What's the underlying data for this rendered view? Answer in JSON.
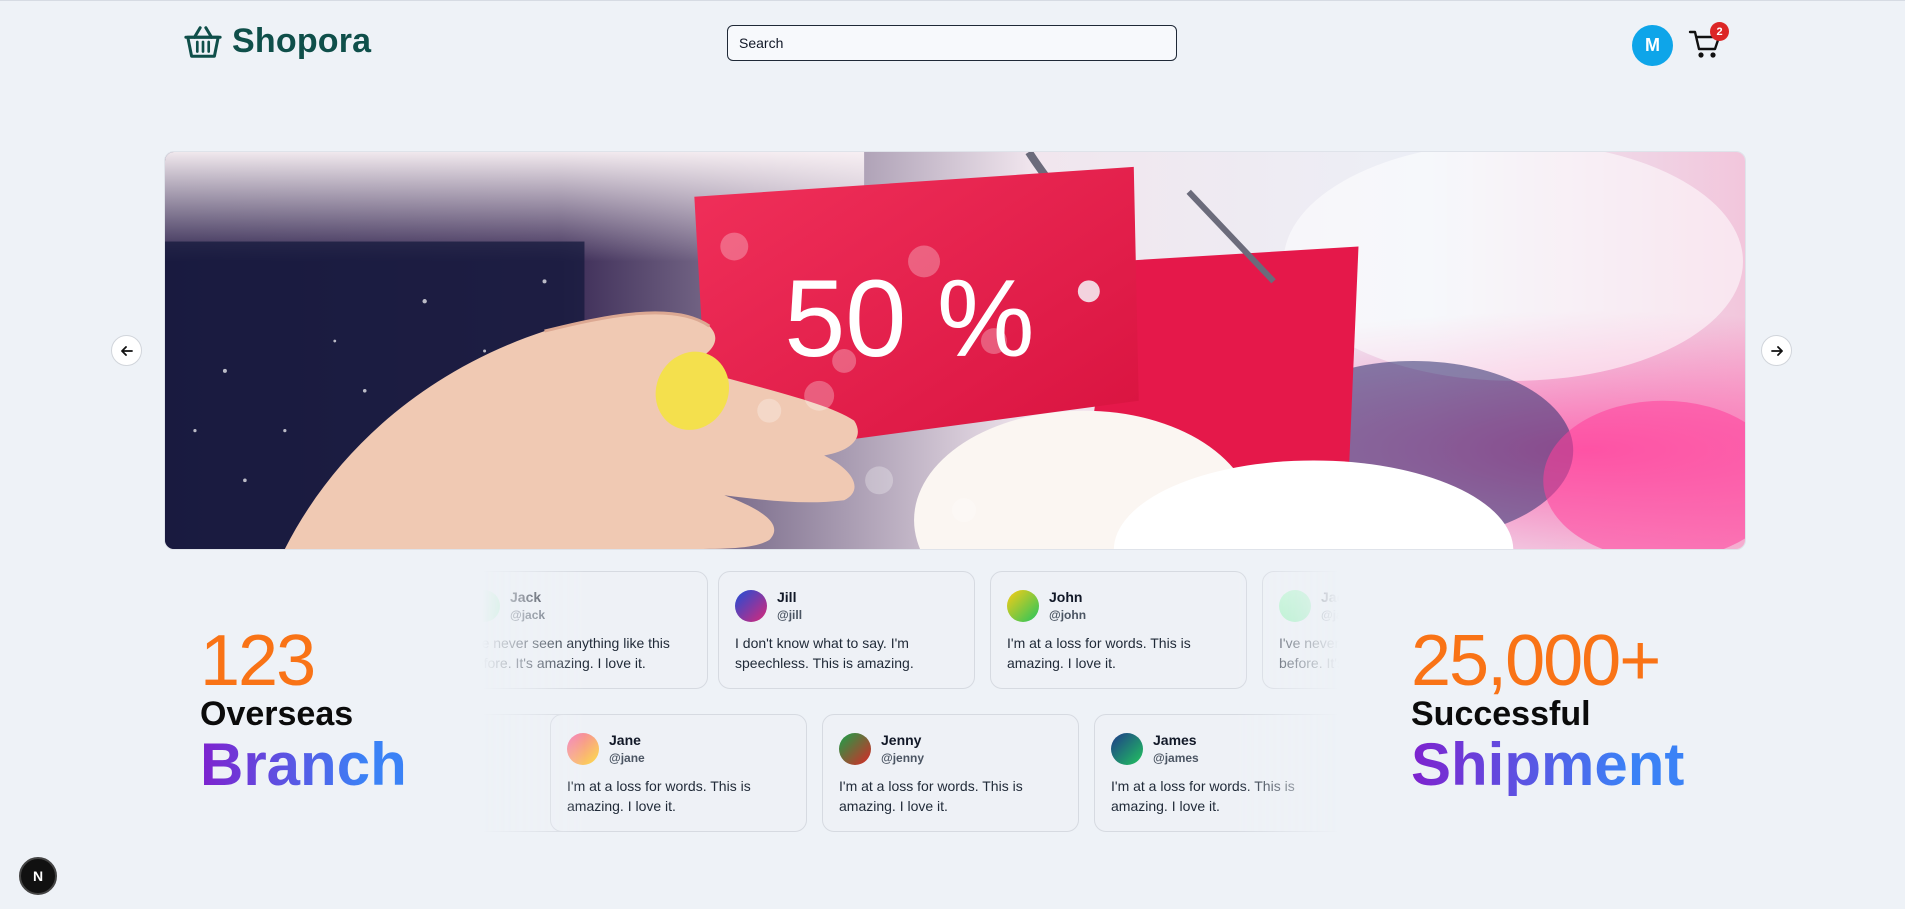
{
  "header": {
    "brand": "Shopora",
    "search_placeholder": "Search",
    "avatar_initial": "M",
    "cart_count": "2"
  },
  "carousel": {
    "prev_icon": "arrow-left-icon",
    "next_icon": "arrow-right-icon",
    "slide_text": "50%"
  },
  "stats": {
    "left": {
      "number": "123",
      "label": "Overseas",
      "word": "Branch"
    },
    "right": {
      "number": "25,000+",
      "label": "Successful",
      "word": "Shipment"
    }
  },
  "reviews": {
    "row1": [
      {
        "name": "Jack",
        "handle": "@jack",
        "body": "I've never seen anything like this before. It's amazing. I love it.",
        "color_a": "#bbf7d0",
        "color_b": "#86efac"
      },
      {
        "name": "Jill",
        "handle": "@jill",
        "body": "I don't know what to say. I'm speechless. This is amazing.",
        "color_a": "#1d4ed8",
        "color_b": "#db2777"
      },
      {
        "name": "John",
        "handle": "@john",
        "body": "I'm at a loss for words. This is amazing. I love it.",
        "color_a": "#facc15",
        "color_b": "#22c55e"
      },
      {
        "name": "Jack",
        "handle": "@jack",
        "body": "I've never seen anything like this before. It's amazing. I love it.",
        "color_a": "#bbf7d0",
        "color_b": "#86efac"
      }
    ],
    "row2": [
      {
        "name": "Jane",
        "handle": "@jane",
        "body": "I'm at a loss for words. This is amazing. I love it.",
        "color_a": "#f472b6",
        "color_b": "#fde047"
      },
      {
        "name": "Jenny",
        "handle": "@jenny",
        "body": "I'm at a loss for words. This is amazing. I love it.",
        "color_a": "#16a34a",
        "color_b": "#dc2626"
      },
      {
        "name": "James",
        "handle": "@james",
        "body": "I'm at a loss for words. This is amazing. I love it.",
        "color_a": "#1e3a8a",
        "color_b": "#22c55e"
      }
    ]
  },
  "devtools_badge": "N"
}
